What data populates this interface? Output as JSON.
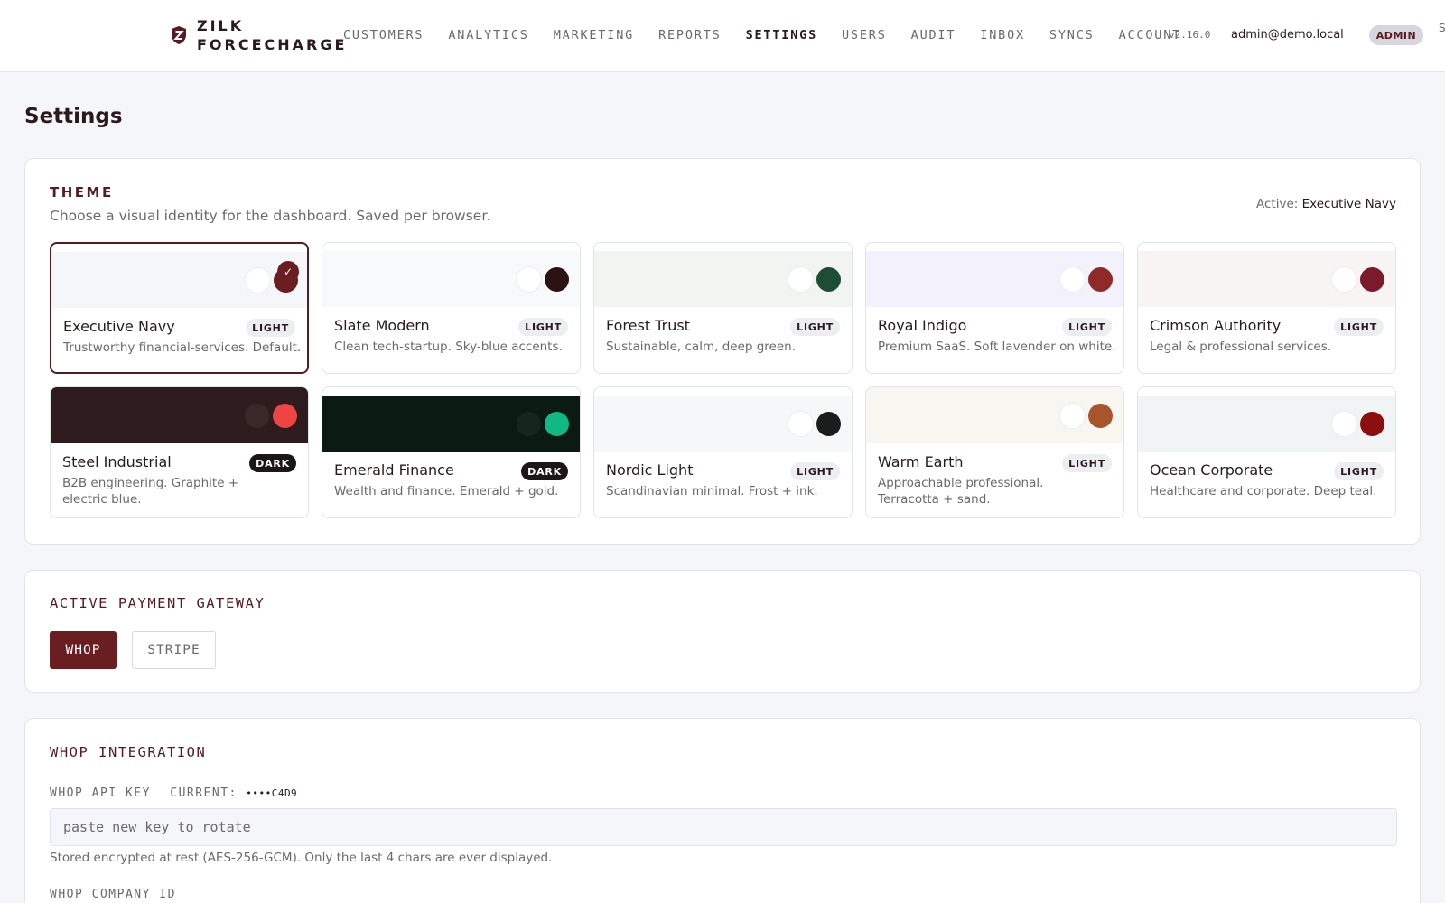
{
  "brand": {
    "line1": "ZILK",
    "line2": "FORCECHARGE",
    "icon": "shield-z-icon"
  },
  "nav": [
    {
      "label": "CUSTOMERS"
    },
    {
      "label": "ANALYTICS"
    },
    {
      "label": "MARKETING"
    },
    {
      "label": "REPORTS"
    },
    {
      "label": "SETTINGS",
      "active": true
    },
    {
      "label": "USERS"
    },
    {
      "label": "AUDIT"
    },
    {
      "label": "INBOX"
    },
    {
      "label": "SYNCS"
    },
    {
      "label": "ACCOUNT"
    }
  ],
  "header": {
    "version": "v2.16.0",
    "email": "admin@demo.local",
    "role": "ADMIN",
    "edge": "S"
  },
  "page": {
    "title": "Settings"
  },
  "theme": {
    "title": "THEME",
    "description": "Choose a visual identity for the dashboard. Saved per browser.",
    "active_prefix": "Active:",
    "active_name": "Executive Navy",
    "selected_mark": "✓",
    "themes": [
      {
        "name": "Executive Navy",
        "mode": "LIGHT",
        "desc": "Trustworthy financial-services. Default.",
        "bg": "#f5f6f9",
        "sw1": "#ffffff",
        "sw2": "#6b1e22"
      },
      {
        "name": "Slate Modern",
        "mode": "LIGHT",
        "desc": "Clean tech-startup. Sky-blue accents.",
        "bg": "#f8f9fb",
        "sw1": "#ffffff",
        "sw2": "#2a1312"
      },
      {
        "name": "Forest Trust",
        "mode": "LIGHT",
        "desc": "Sustainable, calm, deep green.",
        "bg": "#f1f4f0",
        "sw1": "#ffffff",
        "sw2": "#1e4d36"
      },
      {
        "name": "Royal Indigo",
        "mode": "LIGHT",
        "desc": "Premium SaaS. Soft lavender on white.",
        "bg": "#f3f2fc",
        "sw1": "#ffffff",
        "sw2": "#8f2a28"
      },
      {
        "name": "Crimson Authority",
        "mode": "LIGHT",
        "desc": "Legal & professional services.",
        "bg": "#f7f4f3",
        "sw1": "#ffffff",
        "sw2": "#7a1a2a"
      },
      {
        "name": "Steel Industrial",
        "mode": "DARK",
        "desc": "B2B engineering. Graphite + electric blue.",
        "bg": "#2e1b1d",
        "sw1": "#3b2628",
        "sw2": "#ef4444"
      },
      {
        "name": "Emerald Finance",
        "mode": "DARK",
        "desc": "Wealth and finance. Emerald + gold.",
        "bg": "#0c1a14",
        "sw1": "#13271d",
        "sw2": "#10b981"
      },
      {
        "name": "Nordic Light",
        "mode": "LIGHT",
        "desc": "Scandinavian minimal. Frost + ink.",
        "bg": "#f6f7f8",
        "sw1": "#ffffff",
        "sw2": "#1c1c1c"
      },
      {
        "name": "Warm Earth",
        "mode": "LIGHT",
        "desc": "Approachable professional. Terracotta + sand.",
        "bg": "#f8f6f1",
        "sw1": "#ffffff",
        "sw2": "#a8552b"
      },
      {
        "name": "Ocean Corporate",
        "mode": "LIGHT",
        "desc": "Healthcare and corporate. Deep teal.",
        "bg": "#f0f4f4",
        "sw1": "#ffffff",
        "sw2": "#8b0f0f"
      }
    ]
  },
  "gateway": {
    "title": "ACTIVE PAYMENT GATEWAY",
    "options": [
      "WHOP",
      "STRIPE"
    ],
    "selected": "WHOP"
  },
  "whop": {
    "title": "WHOP INTEGRATION",
    "api_key_label": "WHOP API KEY",
    "current_label": "CURRENT:",
    "current_value": "••••C4D9",
    "api_key_placeholder": "paste new key to rotate",
    "help": "Stored encrypted at rest (AES-256-GCM). Only the last 4 chars are ever displayed.",
    "company_id_label": "WHOP COMPANY ID"
  },
  "colors": {
    "accent": "#6b1e22",
    "text": "#2b1a1c",
    "muted": "#6b6870",
    "page_bg": "#f5f6f9"
  }
}
